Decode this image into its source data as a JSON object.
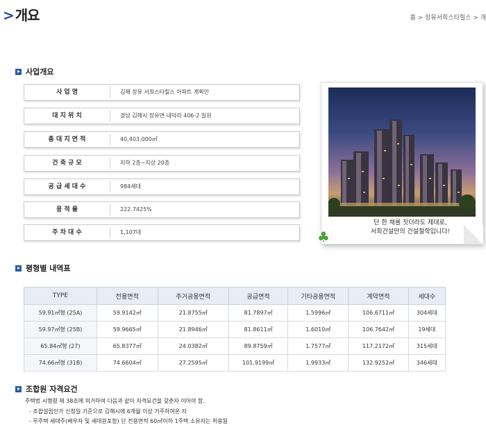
{
  "page": {
    "title": "개요",
    "breadcrumb": "홈 > 장유서희스타힐스 > 개"
  },
  "overview": {
    "heading": "사업개요",
    "rows": [
      {
        "label": "사 업 명",
        "value": "김해 장유 서희스타힐스 아파트 계획안"
      },
      {
        "label": "대 지 위 치",
        "value": "경남 김해시 장유면 내덕리 406-2 일원"
      },
      {
        "label": "총 대 지 면 적",
        "value": "40,403,000㎡"
      },
      {
        "label": "건 축 규 모",
        "value": "지하 2층~지상 20층"
      },
      {
        "label": "공 급 세 대 수",
        "value": "984세대"
      },
      {
        "label": "용 적 율",
        "value": "222.7425%"
      },
      {
        "label": "주 차 대 수",
        "value": "1,107대"
      }
    ]
  },
  "photo": {
    "caption_line1": "단 한 채를 짓더라도 제대로,",
    "caption_line2": "서희건설만의 건설철학입니다!"
  },
  "units": {
    "heading": "평형별 내역표",
    "headers": [
      "TYPE",
      "전용면적",
      "주거공용면적",
      "공급면적",
      "기타공용면적",
      "계약면적",
      "세대수"
    ],
    "rows": [
      [
        "59.91㎡형 (25A)",
        "59.9142㎡",
        "21.8755㎡",
        "81.7897㎡",
        "1.5996㎡",
        "106.6711㎡",
        "304세대"
      ],
      [
        "59.97㎡형 (25B)",
        "59.9665㎡",
        "21.8946㎡",
        "81.8611㎡",
        "1.6010㎡",
        "106.7642㎡",
        "19세대"
      ],
      [
        "65.84㎡형 (27)",
        "65.8377㎡",
        "24.0382㎡",
        "89.8759㎡",
        "1.7577㎡",
        "117.2172㎡",
        "315세대"
      ],
      [
        "74.66㎡형 (31B)",
        "74.6604㎡",
        "27.2595㎡",
        "101.9199㎡",
        "1.9933㎡",
        "132.9252㎡",
        "346세대"
      ]
    ]
  },
  "requirements": {
    "heading": "조합원 자격요건",
    "intro": "주택법 시행령 제 38조에 의거하여 다음과 같이 자격요건을 갖춘자 이어야 함.",
    "items": [
      "- 조합설립인가 신청일 기준으로 김해시에 6개월 이상 거주하여온 자",
      "- 무주택 세대주(배우자 및 세대원포함) 단 전용면적 60㎡이하 1주택 소유자는 허용됨"
    ]
  },
  "colors": {
    "accent": "#2c5aa0",
    "table_header_bg": "#e6edf5"
  }
}
